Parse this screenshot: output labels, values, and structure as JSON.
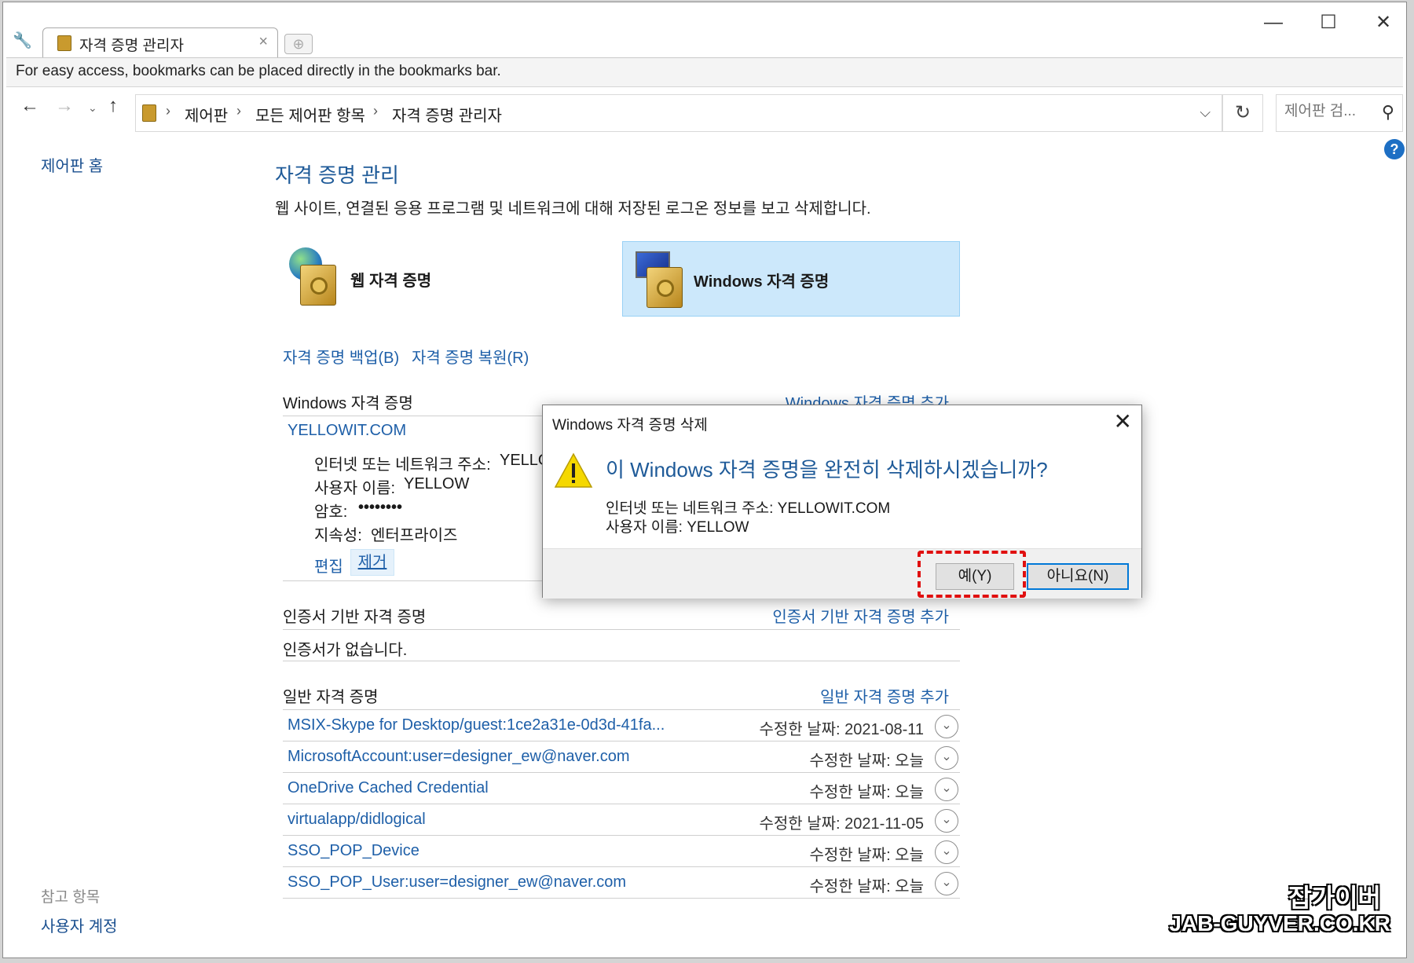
{
  "tab": {
    "title": "자격 증명 관리자",
    "close": "×"
  },
  "window_controls": {
    "minimize": "—",
    "maximize": "☐",
    "close": "✕"
  },
  "bookmark_bar": {
    "text": "For easy access, bookmarks can be placed directly in the bookmarks bar."
  },
  "address": {
    "breadcrumbs": [
      "제어판",
      "모든 제어판 항목",
      "자격 증명 관리자"
    ],
    "separator": "›",
    "search_placeholder": "제어판 검..."
  },
  "left_pane": {
    "home": "제어판 홈",
    "see_also": "참고 항목",
    "user_accounts": "사용자 계정"
  },
  "main": {
    "title": "자격 증명 관리",
    "description": "웹 사이트, 연결된 응용 프로그램 및 네트워크에 대해 저장된 로그온 정보를 보고 삭제합니다.",
    "web_credentials": "웹 자격 증명",
    "windows_credentials": "Windows 자격 증명",
    "backup": "자격 증명 백업(B)",
    "restore": "자격 증명 복원(R)",
    "windows_section": {
      "header": "Windows 자격 증명",
      "add_link": "Windows 자격 증명 추가",
      "entry": {
        "name": "YELLOWIT.COM",
        "address_label": "인터넷 또는 네트워크 주소:",
        "address_value": "YELLO",
        "user_label": "사용자 이름:",
        "user_value": "YELLOW",
        "password_label": "암호:",
        "password_value": "••••••••",
        "persistence_label": "지속성:",
        "persistence_value": "엔터프라이즈",
        "edit": "편집",
        "remove": "제거"
      }
    },
    "cert_section": {
      "header": "인증서 기반 자격 증명",
      "add_link": "인증서 기반 자격 증명 추가",
      "empty": "인증서가 없습니다."
    },
    "general_section": {
      "header": "일반 자격 증명",
      "add_link": "일반 자격 증명 추가",
      "rows": [
        {
          "name": "MSIX-Skype for Desktop/guest:1ce2a31e-0d3d-41fa...",
          "modified": "수정한 날짜:  2021-08-11"
        },
        {
          "name": "MicrosoftAccount:user=designer_ew@naver.com",
          "modified": "수정한 날짜:  오늘"
        },
        {
          "name": "OneDrive Cached Credential",
          "modified": "수정한 날짜:  오늘"
        },
        {
          "name": "virtualapp/didlogical",
          "modified": "수정한 날짜:  2021-11-05"
        },
        {
          "name": "SSO_POP_Device",
          "modified": "수정한 날짜:  오늘"
        },
        {
          "name": "SSO_POP_User:user=designer_ew@naver.com",
          "modified": "수정한 날짜:  오늘"
        }
      ]
    }
  },
  "dialog": {
    "title": "Windows 자격 증명 삭제",
    "question": "이 Windows 자격 증명을 완전히 삭제하시겠습니까?",
    "detail_address": "인터넷 또는 네트워크 주소: YELLOWIT.COM",
    "detail_user": "사용자 이름: YELLOW",
    "yes": "예(Y)",
    "no": "아니요(N)"
  },
  "watermark": {
    "line1": "잡가이버",
    "line2": "JAB-GUYVER.CO.KR"
  },
  "colors": {
    "accent": "#1e5fa8",
    "selected_tile": "#cce8fb",
    "highlight": "#e01010"
  }
}
